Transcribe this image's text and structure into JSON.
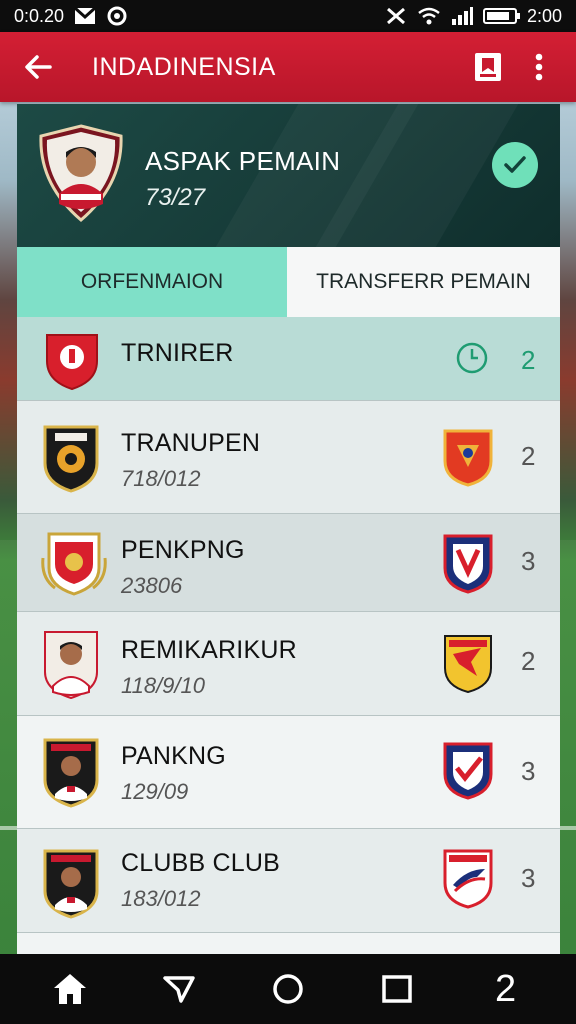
{
  "status_bar": {
    "time_left": "0:0.20",
    "time_right": "2:00",
    "icons": [
      "gmail-icon",
      "sync-icon",
      "mute-icon",
      "wifi-icon",
      "signal-icon",
      "battery-icon"
    ],
    "battery_level": 0.85
  },
  "app_bar": {
    "title": "INDADINENSIA",
    "back_icon": "arrow-left-icon",
    "bookmark_icon": "bookmark-icon",
    "more_icon": "more-vert-icon",
    "color": "#c8192f"
  },
  "profile": {
    "name": "ASPAK PEMAIN",
    "date": "73/27",
    "check_icon": "check-icon",
    "accent": "#6fe0b9"
  },
  "tabs": [
    {
      "label": "ORFENMAION",
      "active": true
    },
    {
      "label": "TRANSFERR PEMAIN",
      "active": false
    }
  ],
  "list": [
    {
      "name": "TRNIRER",
      "date": "",
      "count": "2",
      "left_icon": "club-crest-icon",
      "right_icon": "timer-icon"
    },
    {
      "name": "TRANUPEN",
      "date": "718/012",
      "count": "2",
      "left_icon": "club-crest-icon",
      "right_icon": "club-crest-icon"
    },
    {
      "name": "PENKPNG",
      "date": "23806",
      "count": "3",
      "left_icon": "club-crest-icon",
      "right_icon": "club-crest-icon"
    },
    {
      "name": "REMIKARIKUR",
      "date": "118/9/10",
      "count": "2",
      "left_icon": "player-avatar-icon",
      "right_icon": "club-crest-icon"
    },
    {
      "name": "PANKNG",
      "date": "129/09",
      "count": "3",
      "left_icon": "player-avatar-icon",
      "right_icon": "club-crest-icon"
    },
    {
      "name": "CLUBB CLUB",
      "date": "183/012",
      "count": "3",
      "left_icon": "player-avatar-icon",
      "right_icon": "club-crest-icon"
    }
  ],
  "nav_bar": {
    "icons": [
      "home-icon",
      "send-icon",
      "circle-icon",
      "square-icon"
    ],
    "last_label": "2"
  }
}
